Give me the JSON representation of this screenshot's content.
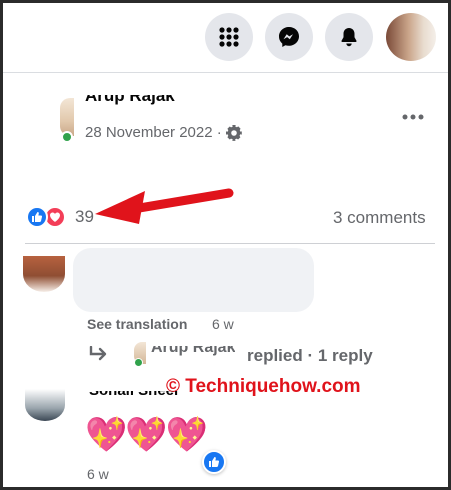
{
  "topbar": {
    "menu_icon": "grid-menu-icon",
    "messenger_icon": "messenger-icon",
    "notifications_icon": "bell-icon"
  },
  "post": {
    "author": "Arup Rajak",
    "date": "28 November 2022 ·",
    "privacy_icon": "gear-icon",
    "more_icon": "more-dots-icon",
    "reactions": {
      "icons": [
        "like-icon",
        "love-icon"
      ],
      "count": "39"
    },
    "comments_count": "3 comments"
  },
  "comments": [
    {
      "actions": {
        "see_translation": "See translation",
        "time": "6 w"
      },
      "reply": {
        "name": "Arup Rajak",
        "text": "replied · 1 reply"
      }
    },
    {
      "name": "Sonali Sheel",
      "emojis": "💖💖💖",
      "time": "6 w"
    }
  ],
  "watermark": "© Techniquehow.com",
  "colors": {
    "accent_blue": "#1877f2",
    "love_red": "#f33e58",
    "arrow_red": "#e0131b",
    "online_green": "#31a24c"
  }
}
